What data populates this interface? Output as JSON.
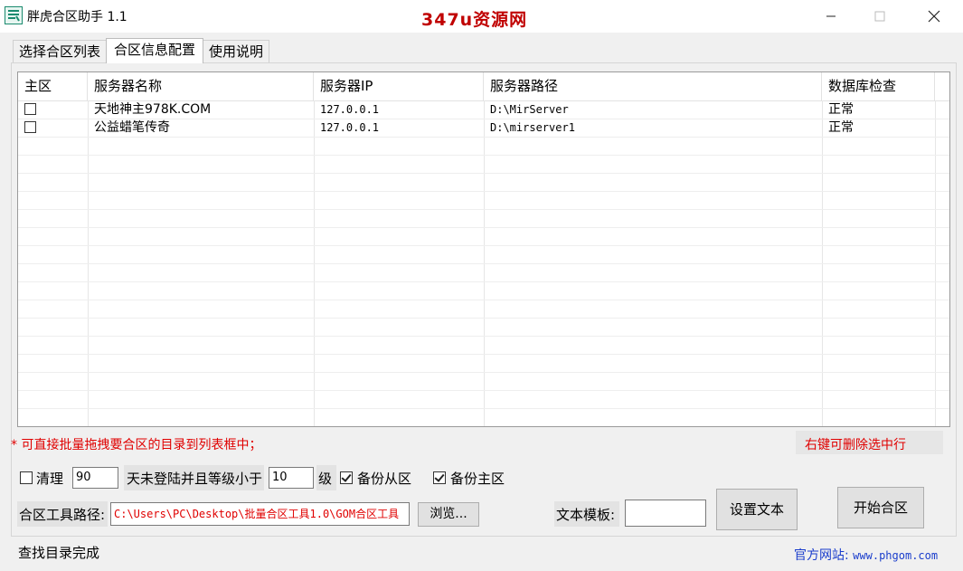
{
  "window": {
    "title": "胖虎合区助手 1.1",
    "watermark": "347u资源网"
  },
  "tabs": [
    {
      "label": "选择合区列表",
      "active": false
    },
    {
      "label": "合区信息配置",
      "active": true
    },
    {
      "label": "使用说明",
      "active": false
    }
  ],
  "table": {
    "columns": [
      "主区",
      "服务器名称",
      "服务器IP",
      "服务器路径",
      "数据库检查"
    ],
    "rows": [
      {
        "main": false,
        "name": "天地神主978K.COM",
        "ip": "127.0.0.1",
        "path": "D:\\MirServer",
        "db": "正常"
      },
      {
        "main": false,
        "name": "公益蜡笔传奇",
        "ip": "127.0.0.1",
        "path": "D:\\mirserver1",
        "db": "正常"
      }
    ]
  },
  "hints": {
    "left": "* 可直接批量拖拽要合区的目录到列表框中；",
    "right": "右键可删除选中行"
  },
  "options": {
    "clean_label": "清理",
    "clean_checked": false,
    "days_value": "90",
    "middle_label": "天未登陆并且等级小于",
    "level_value": "10",
    "level_unit": "级",
    "backup_slave_label": "备份从区",
    "backup_slave_checked": true,
    "backup_main_label": "备份主区",
    "backup_main_checked": true
  },
  "tool": {
    "path_label": "合区工具路径:",
    "path_value": "C:\\Users\\PC\\Desktop\\批量合区工具1.0\\GOM合区工具",
    "browse_label": "浏览...",
    "template_label": "文本模板:",
    "template_value": "",
    "set_text_label": "设置文本",
    "start_label": "开始合区"
  },
  "status": {
    "text": "查找目录完成",
    "site_label": "官方网站:",
    "site_url": "www.phgom.com"
  },
  "colors": {
    "accent_red": "#e00000",
    "link_blue": "#1a3dcc",
    "watermark_red": "#c00000"
  }
}
